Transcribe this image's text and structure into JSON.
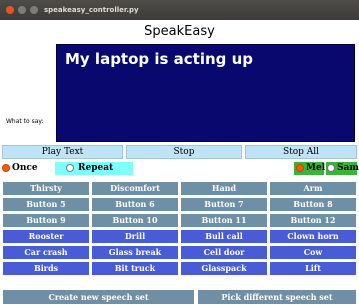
{
  "window": {
    "title": "speakeasy_controller.py"
  },
  "app": {
    "title": "SpeakEasy"
  },
  "speech": {
    "label": "What to say:",
    "text": "My laptop is acting up"
  },
  "controls": {
    "play": "Play Text",
    "stop": "Stop",
    "stop_all": "Stop All"
  },
  "mode": {
    "once": "Once",
    "repeat": "Repeat",
    "selected": "Once"
  },
  "voices": {
    "mel": "Mel",
    "sam": "Sam",
    "selected": "Mel"
  },
  "buttons": [
    {
      "label": "Thirsty",
      "style": "gray"
    },
    {
      "label": "Discomfort",
      "style": "gray"
    },
    {
      "label": "Hand",
      "style": "gray"
    },
    {
      "label": "Arm",
      "style": "gray"
    },
    {
      "label": "Button 5",
      "style": "gray"
    },
    {
      "label": "Button 6",
      "style": "gray"
    },
    {
      "label": "Button 7",
      "style": "gray"
    },
    {
      "label": "Button 8",
      "style": "gray"
    },
    {
      "label": "Button 9",
      "style": "gray"
    },
    {
      "label": "Button 10",
      "style": "gray"
    },
    {
      "label": "Button 11",
      "style": "gray"
    },
    {
      "label": "Button 12",
      "style": "gray"
    },
    {
      "label": "Rooster",
      "style": "blue"
    },
    {
      "label": "Drill",
      "style": "blue"
    },
    {
      "label": "Bull call",
      "style": "blue"
    },
    {
      "label": "Clown horn",
      "style": "blue"
    },
    {
      "label": "Car crash",
      "style": "blue"
    },
    {
      "label": "Glass break",
      "style": "blue"
    },
    {
      "label": "Cell door",
      "style": "blue"
    },
    {
      "label": "Cow",
      "style": "blue"
    },
    {
      "label": "Birds",
      "style": "blue"
    },
    {
      "label": "Bit truck",
      "style": "blue"
    },
    {
      "label": "Glasspack",
      "style": "blue"
    },
    {
      "label": "Lift",
      "style": "blue"
    }
  ],
  "footer": {
    "create": "Create new speech set",
    "pick": "Pick different speech set"
  },
  "colors": {
    "text_area_bg": "#08086e",
    "control_button_bg": "#bfe3f7",
    "program_button_bg": "#6f8fa7",
    "sound_button_bg": "#4a5bd8",
    "repeat_highlight": "#7fffff",
    "voice_highlight": "#39b439",
    "radio_selected": "#ff5a00"
  }
}
